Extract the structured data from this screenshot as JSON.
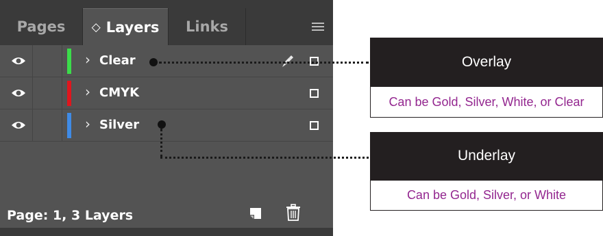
{
  "panel": {
    "tabs": [
      {
        "label": "Pages"
      },
      {
        "label": "Layers",
        "caret": "◇"
      },
      {
        "label": "Links"
      }
    ],
    "layers": [
      {
        "name": "Clear",
        "color": "#3bdc4a",
        "visible": true,
        "has_pen": true
      },
      {
        "name": "CMYK",
        "color": "#e0161d",
        "visible": true,
        "has_pen": false
      },
      {
        "name": "Silver",
        "color": "#3f8be6",
        "visible": true,
        "has_pen": false
      }
    ],
    "footer": {
      "status": "Page: 1, 3 Layers"
    },
    "colors": {
      "panel_bg": "#535353",
      "tab_bg": "#3a3a3a"
    }
  },
  "callouts": {
    "overlay": {
      "title": "Overlay",
      "desc": "Can be Gold, Silver, White, or Clear"
    },
    "underlay": {
      "title": "Underlay",
      "desc": "Can be Gold, Silver, or White"
    },
    "colors": {
      "head_bg": "#231f20",
      "desc_text": "#93268f"
    }
  }
}
